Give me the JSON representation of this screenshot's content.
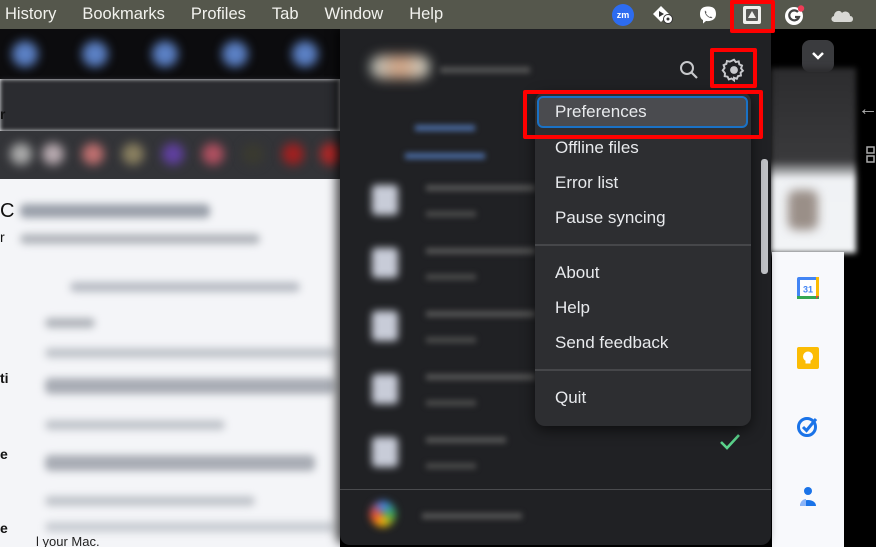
{
  "menubar": {
    "items": [
      "History",
      "Bookmarks",
      "Profiles",
      "Tab",
      "Window",
      "Help"
    ],
    "tray_icons": [
      "zoom-icon",
      "video-speed-icon",
      "viber-icon",
      "google-drive-icon",
      "grammarly-icon",
      "onedrive-icon"
    ],
    "zoom_label": "zm"
  },
  "drive_panel": {
    "header_icons": [
      "search-icon",
      "settings-gear-icon"
    ],
    "sync_status": "synced"
  },
  "dropdown": {
    "items": [
      {
        "label": "Preferences",
        "selected": true
      },
      {
        "label": "Offline files"
      },
      {
        "label": "Error list"
      },
      {
        "label": "Pause syncing"
      },
      {
        "label": "About"
      },
      {
        "label": "Help"
      },
      {
        "label": "Send feedback"
      },
      {
        "label": "Quit"
      }
    ]
  },
  "side_panel": {
    "apps": [
      "google-calendar",
      "google-keep",
      "google-tasks",
      "google-contacts"
    ],
    "calendar_day": "31"
  },
  "background": {
    "bottom_text": "l your Mac.",
    "edge_letters": [
      "r",
      "C",
      "r",
      "ti",
      "e",
      "e"
    ]
  },
  "colors": {
    "highlight": "#ff0000",
    "menu_bg": "#2d2e31",
    "selection_border": "#1a72c6",
    "check": "#5bd48c"
  }
}
